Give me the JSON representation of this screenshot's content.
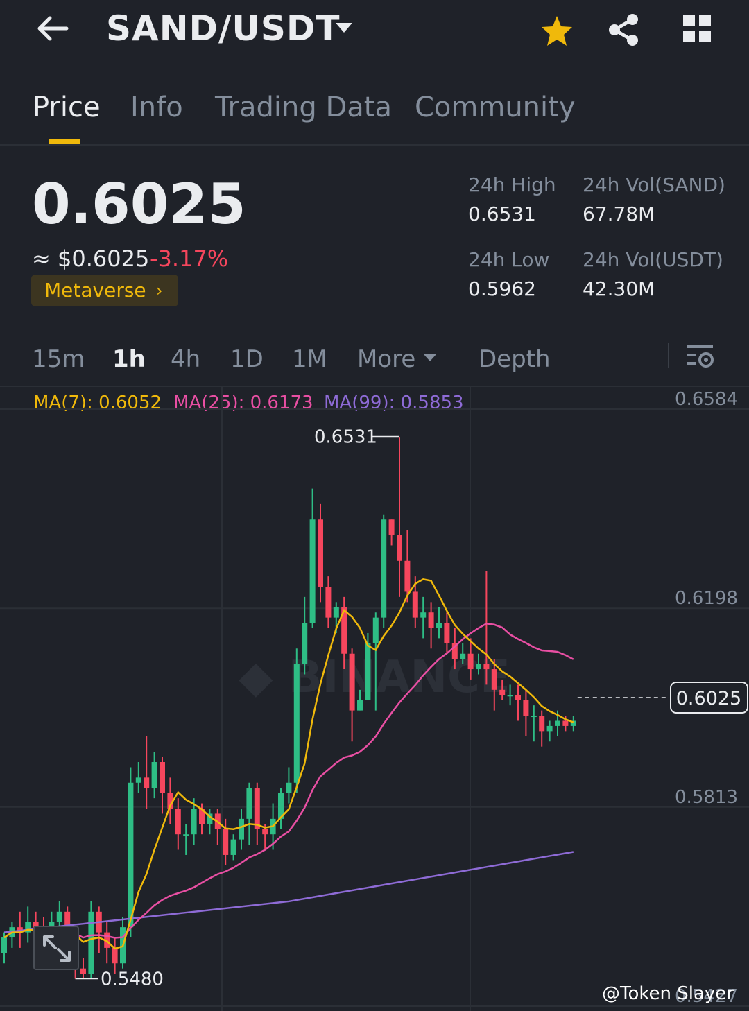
{
  "header": {
    "pair": "SAND/USDT"
  },
  "tabs": [
    "Price",
    "Info",
    "Trading Data",
    "Community"
  ],
  "price": {
    "last": "0.6025",
    "fiat": "≈ $0.6025",
    "change": "-3.17%",
    "tag": "Metaverse"
  },
  "stats": {
    "high_label": "24h High",
    "high": "0.6531",
    "low_label": "24h Low",
    "low": "0.5962",
    "vol_base_label": "24h Vol(SAND)",
    "vol_base": "67.78M",
    "vol_quote_label": "24h Vol(USDT)",
    "vol_quote": "42.30M"
  },
  "intervals": {
    "m15": "15m",
    "h1": "1h",
    "h4": "4h",
    "d1": "1D",
    "mo1": "1M",
    "more": "More",
    "depth": "Depth"
  },
  "ma": {
    "ma7": "MA(7): 0.6052",
    "ma25": "MA(25): 0.6173",
    "ma99": "MA(99): 0.5853"
  },
  "colors": {
    "up": "#2ebd85",
    "down": "#f6465d",
    "accent": "#f0b90b",
    "ma7": "#f0b90b",
    "ma25": "#e84fa3",
    "ma99": "#8e6bd6",
    "background": "#1f2229"
  },
  "watermark": "@Token Slayer",
  "chart_data": {
    "type": "candlestick",
    "price_axis": [
      "0.6584",
      "0.6198",
      "0.5813",
      "0.5427"
    ],
    "current_price": "0.6025",
    "high_marker": "0.6531",
    "low_marker": "0.5480",
    "candles": [
      [
        0.553,
        0.556,
        0.551,
        0.557
      ],
      [
        0.556,
        0.558,
        0.554,
        0.559
      ],
      [
        0.558,
        0.557,
        0.554,
        0.561
      ],
      [
        0.557,
        0.559,
        0.555,
        0.562
      ],
      [
        0.559,
        0.557,
        0.554,
        0.561
      ],
      [
        0.557,
        0.555,
        0.552,
        0.56
      ],
      [
        0.555,
        0.559,
        0.553,
        0.561
      ],
      [
        0.559,
        0.561,
        0.556,
        0.563
      ],
      [
        0.561,
        0.555,
        0.551,
        0.562
      ],
      [
        0.555,
        0.55,
        0.548,
        0.557
      ],
      [
        0.55,
        0.549,
        0.548,
        0.552
      ],
      [
        0.549,
        0.561,
        0.548,
        0.563
      ],
      [
        0.561,
        0.557,
        0.553,
        0.562
      ],
      [
        0.557,
        0.554,
        0.551,
        0.559
      ],
      [
        0.554,
        0.551,
        0.549,
        0.556
      ],
      [
        0.551,
        0.558,
        0.55,
        0.56
      ],
      [
        0.558,
        0.586,
        0.556,
        0.589
      ],
      [
        0.586,
        0.587,
        0.584,
        0.59
      ],
      [
        0.587,
        0.585,
        0.581,
        0.595
      ],
      [
        0.585,
        0.59,
        0.583,
        0.592
      ],
      [
        0.59,
        0.584,
        0.58,
        0.591
      ],
      [
        0.584,
        0.581,
        0.578,
        0.587
      ],
      [
        0.581,
        0.576,
        0.573,
        0.583
      ],
      [
        0.576,
        0.576,
        0.572,
        0.578
      ],
      [
        0.576,
        0.581,
        0.574,
        0.583
      ],
      [
        0.581,
        0.578,
        0.576,
        0.582
      ],
      [
        0.578,
        0.58,
        0.576,
        0.581
      ],
      [
        0.58,
        0.577,
        0.574,
        0.581
      ],
      [
        0.577,
        0.572,
        0.57,
        0.579
      ],
      [
        0.572,
        0.575,
        0.571,
        0.576
      ],
      [
        0.575,
        0.579,
        0.573,
        0.581
      ],
      [
        0.579,
        0.585,
        0.574,
        0.586
      ],
      [
        0.585,
        0.577,
        0.574,
        0.586
      ],
      [
        0.577,
        0.576,
        0.573,
        0.578
      ],
      [
        0.576,
        0.579,
        0.573,
        0.582
      ],
      [
        0.579,
        0.584,
        0.577,
        0.585
      ],
      [
        0.584,
        0.586,
        0.582,
        0.589
      ],
      [
        0.586,
        0.609,
        0.584,
        0.612
      ],
      [
        0.609,
        0.617,
        0.607,
        0.622
      ],
      [
        0.617,
        0.637,
        0.616,
        0.643
      ],
      [
        0.637,
        0.624,
        0.621,
        0.64
      ],
      [
        0.624,
        0.618,
        0.616,
        0.626
      ],
      [
        0.618,
        0.62,
        0.615,
        0.621
      ],
      [
        0.62,
        0.611,
        0.608,
        0.622
      ],
      [
        0.611,
        0.6,
        0.594,
        0.612
      ],
      [
        0.6,
        0.602,
        0.6,
        0.604
      ],
      [
        0.602,
        0.613,
        0.61,
        0.615
      ],
      [
        0.613,
        0.618,
        0.6,
        0.619
      ],
      [
        0.618,
        0.637,
        0.616,
        0.638
      ],
      [
        0.637,
        0.634,
        0.632,
        0.637
      ],
      [
        0.634,
        0.629,
        0.622,
        0.653
      ],
      [
        0.629,
        0.623,
        0.621,
        0.635
      ],
      [
        0.623,
        0.618,
        0.616,
        0.626
      ],
      [
        0.618,
        0.619,
        0.614,
        0.622
      ],
      [
        0.619,
        0.616,
        0.612,
        0.621
      ],
      [
        0.616,
        0.617,
        0.614,
        0.62
      ],
      [
        0.617,
        0.613,
        0.611,
        0.619
      ],
      [
        0.613,
        0.61,
        0.608,
        0.616
      ],
      [
        0.61,
        0.611,
        0.609,
        0.613
      ],
      [
        0.611,
        0.608,
        0.606,
        0.614
      ],
      [
        0.608,
        0.609,
        0.607,
        0.611
      ],
      [
        0.609,
        0.608,
        0.605,
        0.627
      ],
      [
        0.608,
        0.604,
        0.6,
        0.61
      ],
      [
        0.604,
        0.603,
        0.602,
        0.606
      ],
      [
        0.603,
        0.603,
        0.601,
        0.605
      ],
      [
        0.603,
        0.602,
        0.598,
        0.605
      ],
      [
        0.602,
        0.599,
        0.595,
        0.604
      ],
      [
        0.599,
        0.599,
        0.594,
        0.601
      ],
      [
        0.599,
        0.596,
        0.593,
        0.6
      ],
      [
        0.596,
        0.597,
        0.594,
        0.598
      ],
      [
        0.597,
        0.598,
        0.595,
        0.6
      ],
      [
        0.598,
        0.597,
        0.596,
        0.599
      ],
      [
        0.597,
        0.598,
        0.596,
        0.599
      ]
    ]
  }
}
